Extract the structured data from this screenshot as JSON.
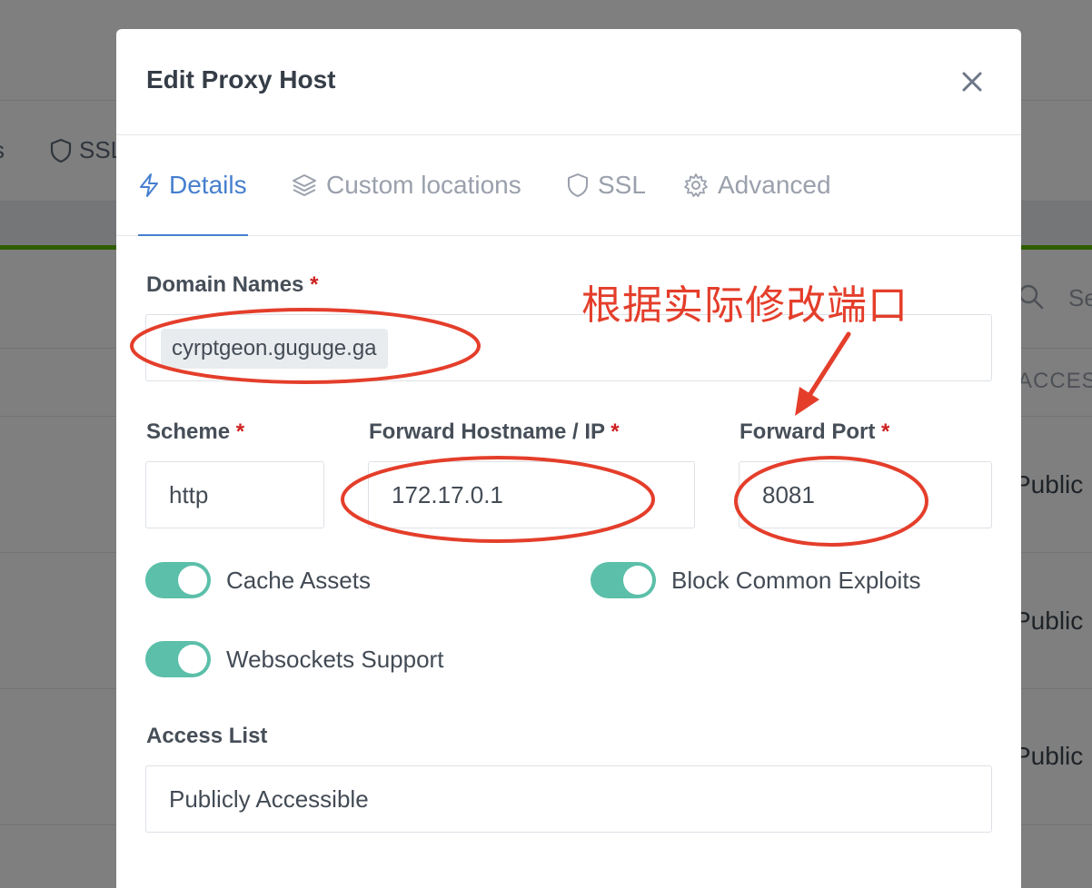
{
  "background": {
    "nav_partial_s": "s",
    "nav_ssl": "SSL",
    "search_placeholder_partial": "Se",
    "access_column_partial": "ACCESS",
    "row_values": [
      "Public",
      "Public",
      "Public"
    ]
  },
  "modal": {
    "title": "Edit Proxy Host",
    "tabs": [
      {
        "label": "Details",
        "icon": "bolt-icon",
        "active": true
      },
      {
        "label": "Custom locations",
        "icon": "layers-icon",
        "active": false
      },
      {
        "label": "SSL",
        "icon": "shield-icon",
        "active": false
      },
      {
        "label": "Advanced",
        "icon": "gear-icon",
        "active": false
      }
    ],
    "domain_names": {
      "label": "Domain Names",
      "required_mark": "*",
      "values": [
        "cyrptgeon.guguge.ga"
      ]
    },
    "scheme": {
      "label": "Scheme",
      "required_mark": "*",
      "value": "http"
    },
    "forward_host": {
      "label": "Forward Hostname / IP",
      "required_mark": "*",
      "value": "172.17.0.1"
    },
    "forward_port": {
      "label": "Forward Port",
      "required_mark": "*",
      "value": "8081"
    },
    "toggles": {
      "cache_assets": {
        "label": "Cache Assets",
        "on": true
      },
      "block_exploits": {
        "label": "Block Common Exploits",
        "on": true
      },
      "websockets": {
        "label": "Websockets Support",
        "on": true
      }
    },
    "access_list": {
      "label": "Access List",
      "value": "Publicly Accessible"
    }
  },
  "annotation": {
    "text": "根据实际修改端口",
    "color": "#e43e2b"
  },
  "colors": {
    "accent": "#467fcf",
    "toggle_on": "#5bbfa9",
    "required": "#cd201f",
    "green_bar": "#5eba00"
  }
}
